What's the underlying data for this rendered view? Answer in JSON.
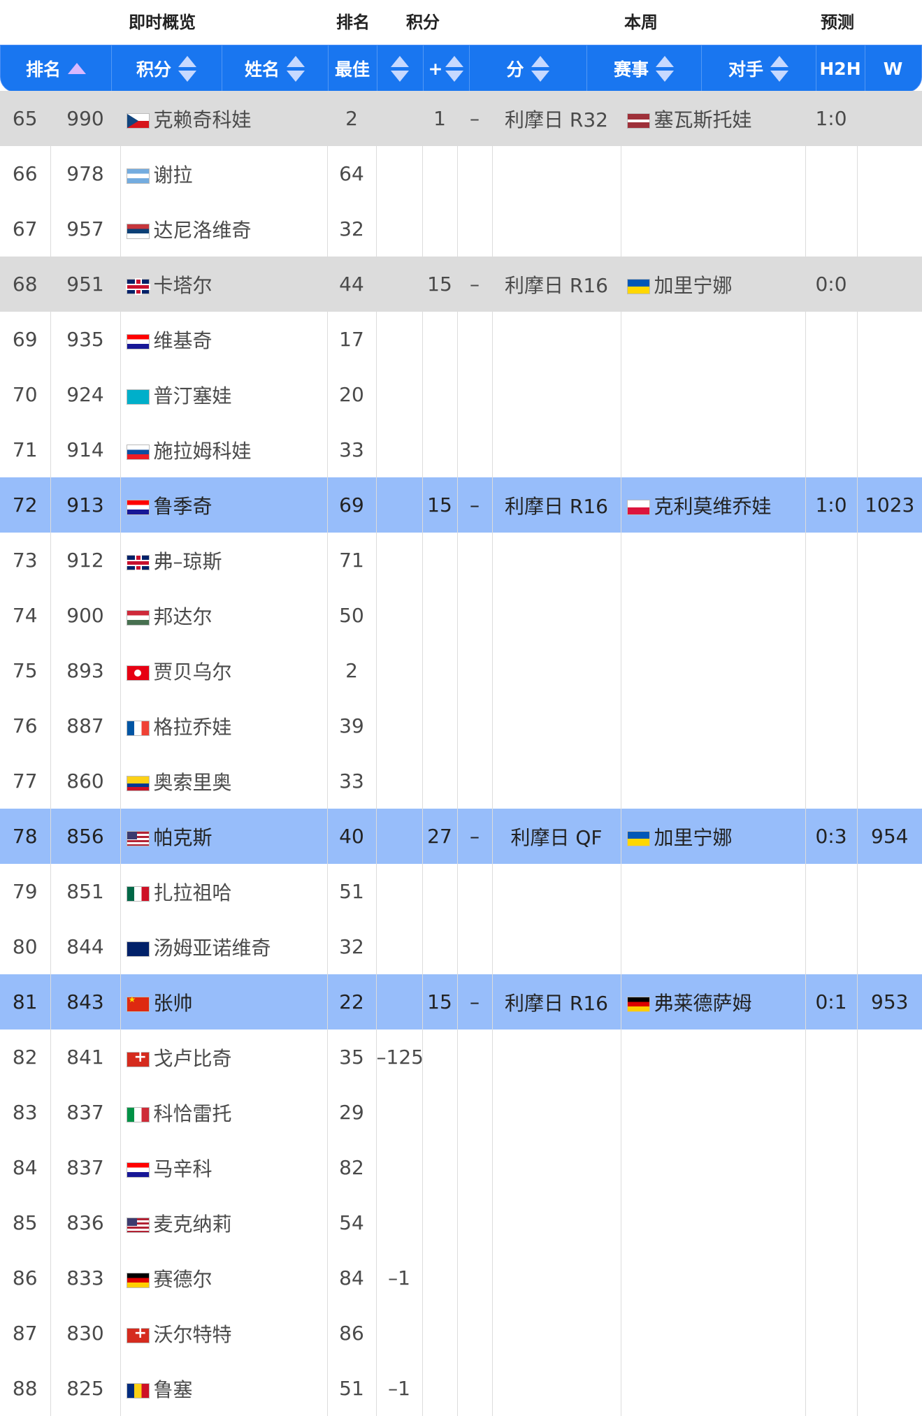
{
  "group_headers": {
    "overview": "即时概览",
    "rank": "排名",
    "points": "积分",
    "this_week": "本周",
    "prediction": "预测"
  },
  "columns": {
    "rank": "排名",
    "points": "积分",
    "name": "姓名",
    "best": "最佳",
    "plus": "+",
    "score": "分",
    "event": "赛事",
    "opponent": "对手",
    "h2h": "H2H",
    "w": "W"
  },
  "colors": {
    "header_blue": "#1976f0",
    "row_gray": "#dcdcdc",
    "row_blue": "#97bdfa"
  },
  "rows": [
    {
      "rank": "65",
      "points": "990",
      "flag": "flag-cz",
      "name": "克赖奇科娃",
      "best": "2",
      "delta": "",
      "plus": "1",
      "dash": "–",
      "event": "利摩日 R32",
      "opp_flag": "flag-lv",
      "opponent": "塞瓦斯托娃",
      "h2h": "1:0",
      "w": "",
      "style": "gray"
    },
    {
      "rank": "66",
      "points": "978",
      "flag": "flag-ar",
      "name": "谢拉",
      "best": "64",
      "delta": "",
      "plus": "",
      "dash": "",
      "event": "",
      "opp_flag": "",
      "opponent": "",
      "h2h": "",
      "w": "",
      "style": ""
    },
    {
      "rank": "67",
      "points": "957",
      "flag": "flag-rs",
      "name": "达尼洛维奇",
      "best": "32",
      "delta": "",
      "plus": "",
      "dash": "",
      "event": "",
      "opp_flag": "",
      "opponent": "",
      "h2h": "",
      "w": "",
      "style": ""
    },
    {
      "rank": "68",
      "points": "951",
      "flag": "flag-gb",
      "name": "卡塔尔",
      "best": "44",
      "delta": "",
      "plus": "15",
      "dash": "–",
      "event": "利摩日 R16",
      "opp_flag": "flag-ua",
      "opponent": "加里宁娜",
      "h2h": "0:0",
      "w": "",
      "style": "gray"
    },
    {
      "rank": "69",
      "points": "935",
      "flag": "flag-hr",
      "name": "维基奇",
      "best": "17",
      "delta": "",
      "plus": "",
      "dash": "",
      "event": "",
      "opp_flag": "",
      "opponent": "",
      "h2h": "",
      "w": "",
      "style": ""
    },
    {
      "rank": "70",
      "points": "924",
      "flag": "flag-kz",
      "name": "普汀塞娃",
      "best": "20",
      "delta": "",
      "plus": "",
      "dash": "",
      "event": "",
      "opp_flag": "",
      "opponent": "",
      "h2h": "",
      "w": "",
      "style": ""
    },
    {
      "rank": "71",
      "points": "914",
      "flag": "flag-sk",
      "name": "施拉姆科娃",
      "best": "33",
      "delta": "",
      "plus": "",
      "dash": "",
      "event": "",
      "opp_flag": "",
      "opponent": "",
      "h2h": "",
      "w": "",
      "style": ""
    },
    {
      "rank": "72",
      "points": "913",
      "flag": "flag-hr",
      "name": "鲁季奇",
      "best": "69",
      "delta": "",
      "plus": "15",
      "dash": "–",
      "event": "利摩日 R16",
      "opp_flag": "flag-pl",
      "opponent": "克利莫维乔娃",
      "h2h": "1:0",
      "w": "1023",
      "style": "blue"
    },
    {
      "rank": "73",
      "points": "912",
      "flag": "flag-gb",
      "name": "弗–琼斯",
      "best": "71",
      "delta": "",
      "plus": "",
      "dash": "",
      "event": "",
      "opp_flag": "",
      "opponent": "",
      "h2h": "",
      "w": "",
      "style": ""
    },
    {
      "rank": "74",
      "points": "900",
      "flag": "flag-hu",
      "name": "邦达尔",
      "best": "50",
      "delta": "",
      "plus": "",
      "dash": "",
      "event": "",
      "opp_flag": "",
      "opponent": "",
      "h2h": "",
      "w": "",
      "style": ""
    },
    {
      "rank": "75",
      "points": "893",
      "flag": "flag-tn",
      "name": "贾贝乌尔",
      "best": "2",
      "delta": "",
      "plus": "",
      "dash": "",
      "event": "",
      "opp_flag": "",
      "opponent": "",
      "h2h": "",
      "w": "",
      "style": ""
    },
    {
      "rank": "76",
      "points": "887",
      "flag": "flag-fr",
      "name": "格拉乔娃",
      "best": "39",
      "delta": "",
      "plus": "",
      "dash": "",
      "event": "",
      "opp_flag": "",
      "opponent": "",
      "h2h": "",
      "w": "",
      "style": ""
    },
    {
      "rank": "77",
      "points": "860",
      "flag": "flag-co",
      "name": "奥索里奥",
      "best": "33",
      "delta": "",
      "plus": "",
      "dash": "",
      "event": "",
      "opp_flag": "",
      "opponent": "",
      "h2h": "",
      "w": "",
      "style": ""
    },
    {
      "rank": "78",
      "points": "856",
      "flag": "flag-us",
      "name": "帕克斯",
      "best": "40",
      "delta": "",
      "plus": "27",
      "dash": "–",
      "event": "利摩日 QF",
      "opp_flag": "flag-ua",
      "opponent": "加里宁娜",
      "h2h": "0:3",
      "w": "954",
      "style": "blue"
    },
    {
      "rank": "79",
      "points": "851",
      "flag": "flag-mx",
      "name": "扎拉祖哈",
      "best": "51",
      "delta": "",
      "plus": "",
      "dash": "",
      "event": "",
      "opp_flag": "",
      "opponent": "",
      "h2h": "",
      "w": "",
      "style": ""
    },
    {
      "rank": "80",
      "points": "844",
      "flag": "flag-au",
      "name": "汤姆亚诺维奇",
      "best": "32",
      "delta": "",
      "plus": "",
      "dash": "",
      "event": "",
      "opp_flag": "",
      "opponent": "",
      "h2h": "",
      "w": "",
      "style": ""
    },
    {
      "rank": "81",
      "points": "843",
      "flag": "flag-cn",
      "name": "张帅",
      "best": "22",
      "delta": "",
      "plus": "15",
      "dash": "–",
      "event": "利摩日 R16",
      "opp_flag": "flag-de",
      "opponent": "弗莱德萨姆",
      "h2h": "0:1",
      "w": "953",
      "style": "blue"
    },
    {
      "rank": "82",
      "points": "841",
      "flag": "flag-ch",
      "name": "戈卢比奇",
      "best": "35",
      "delta": "–125",
      "plus": "",
      "dash": "",
      "event": "",
      "opp_flag": "",
      "opponent": "",
      "h2h": "",
      "w": "",
      "style": ""
    },
    {
      "rank": "83",
      "points": "837",
      "flag": "flag-it",
      "name": "科恰雷托",
      "best": "29",
      "delta": "",
      "plus": "",
      "dash": "",
      "event": "",
      "opp_flag": "",
      "opponent": "",
      "h2h": "",
      "w": "",
      "style": ""
    },
    {
      "rank": "84",
      "points": "837",
      "flag": "flag-hr",
      "name": "马辛科",
      "best": "82",
      "delta": "",
      "plus": "",
      "dash": "",
      "event": "",
      "opp_flag": "",
      "opponent": "",
      "h2h": "",
      "w": "",
      "style": ""
    },
    {
      "rank": "85",
      "points": "836",
      "flag": "flag-us",
      "name": "麦克纳莉",
      "best": "54",
      "delta": "",
      "plus": "",
      "dash": "",
      "event": "",
      "opp_flag": "",
      "opponent": "",
      "h2h": "",
      "w": "",
      "style": ""
    },
    {
      "rank": "86",
      "points": "833",
      "flag": "flag-de",
      "name": "赛德尔",
      "best": "84",
      "delta": "–1",
      "plus": "",
      "dash": "",
      "event": "",
      "opp_flag": "",
      "opponent": "",
      "h2h": "",
      "w": "",
      "style": ""
    },
    {
      "rank": "87",
      "points": "830",
      "flag": "flag-ch",
      "name": "沃尔特特",
      "best": "86",
      "delta": "",
      "plus": "",
      "dash": "",
      "event": "",
      "opp_flag": "",
      "opponent": "",
      "h2h": "",
      "w": "",
      "style": ""
    },
    {
      "rank": "88",
      "points": "825",
      "flag": "flag-ro",
      "name": "鲁塞",
      "best": "51",
      "delta": "–1",
      "plus": "",
      "dash": "",
      "event": "",
      "opp_flag": "",
      "opponent": "",
      "h2h": "",
      "w": "",
      "style": ""
    }
  ]
}
